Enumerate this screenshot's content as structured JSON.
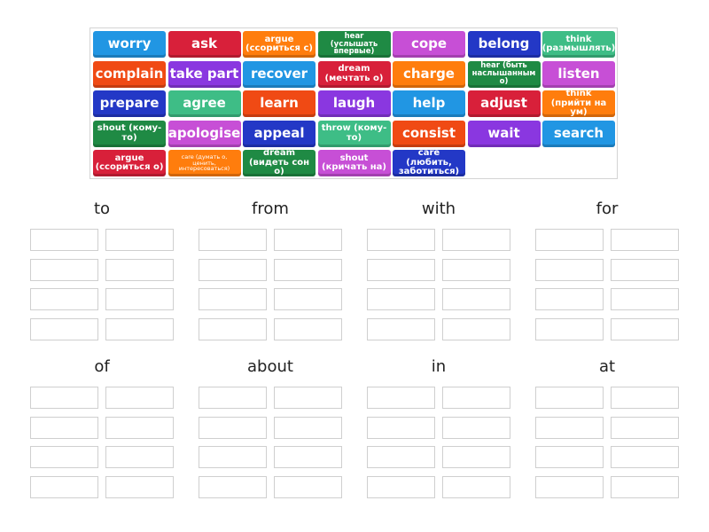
{
  "tiles": [
    {
      "label": "worry",
      "color": "#2196e3",
      "size": "lg"
    },
    {
      "label": "ask",
      "color": "#d8203a",
      "size": "lg"
    },
    {
      "label": "argue (ссориться с)",
      "color": "#ff7d0d",
      "size": "md"
    },
    {
      "label": "hear (услышать впервые)",
      "color": "#1f8a44",
      "size": "sm"
    },
    {
      "label": "cope",
      "color": "#c74fd6",
      "size": "lg"
    },
    {
      "label": "belong",
      "color": "#2338c6",
      "size": "lg"
    },
    {
      "label": "think (размышлять)",
      "color": "#3ebd86",
      "size": "md"
    },
    {
      "label": "complain",
      "color": "#f04a14",
      "size": "lg"
    },
    {
      "label": "take part",
      "color": "#8a37e0",
      "size": "lg"
    },
    {
      "label": "recover",
      "color": "#2196e3",
      "size": "lg"
    },
    {
      "label": "dream (мечтать о)",
      "color": "#d8203a",
      "size": "md"
    },
    {
      "label": "charge",
      "color": "#ff7d0d",
      "size": "lg"
    },
    {
      "label": "hear (быть наслышанным о)",
      "color": "#1f8a44",
      "size": "sm"
    },
    {
      "label": "listen",
      "color": "#c74fd6",
      "size": "lg"
    },
    {
      "label": "prepare",
      "color": "#2338c6",
      "size": "lg"
    },
    {
      "label": "agree",
      "color": "#3ebd86",
      "size": "lg"
    },
    {
      "label": "learn",
      "color": "#f04a14",
      "size": "lg"
    },
    {
      "label": "laugh",
      "color": "#8a37e0",
      "size": "lg"
    },
    {
      "label": "help",
      "color": "#2196e3",
      "size": "lg"
    },
    {
      "label": "adjust",
      "color": "#d8203a",
      "size": "lg"
    },
    {
      "label": "think (прийти на ум)",
      "color": "#ff7d0d",
      "size": "md"
    },
    {
      "label": "shout (кому-то)",
      "color": "#1f8a44",
      "size": "md"
    },
    {
      "label": "apologise",
      "color": "#c74fd6",
      "size": "lg"
    },
    {
      "label": "appeal",
      "color": "#2338c6",
      "size": "lg"
    },
    {
      "label": "throw (кому-то)",
      "color": "#3ebd86",
      "size": "md"
    },
    {
      "label": "consist",
      "color": "#f04a14",
      "size": "lg"
    },
    {
      "label": "wait",
      "color": "#8a37e0",
      "size": "lg"
    },
    {
      "label": "search",
      "color": "#2196e3",
      "size": "lg"
    },
    {
      "label": "argue (ссориться о)",
      "color": "#d8203a",
      "size": "md"
    },
    {
      "label": "care (думать о, ценить, интересоваться)",
      "color": "#ff7d0d",
      "size": "xs"
    },
    {
      "label": "dream (видеть сон о)",
      "color": "#1f8a44",
      "size": "md"
    },
    {
      "label": "shout (кричать на)",
      "color": "#c74fd6",
      "size": "md"
    },
    {
      "label": "care (любить, заботиться)",
      "color": "#2338c6",
      "size": "md"
    }
  ],
  "groups": [
    {
      "title": "to"
    },
    {
      "title": "from"
    },
    {
      "title": "with"
    },
    {
      "title": "for"
    },
    {
      "title": "of"
    },
    {
      "title": "about"
    },
    {
      "title": "in"
    },
    {
      "title": "at"
    }
  ],
  "slots_per_group": 8
}
